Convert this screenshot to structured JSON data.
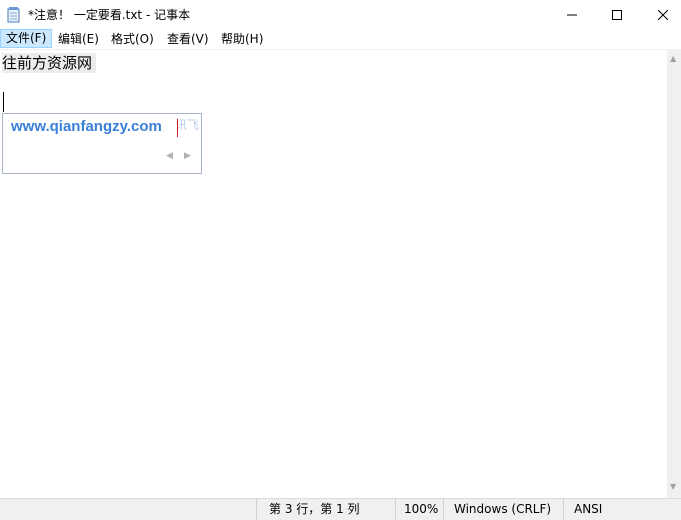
{
  "window": {
    "title": "*注意！ 一定要看.txt - 记事本",
    "icon": "notepad-icon",
    "controls": [
      "minimize-icon",
      "maximize-icon",
      "close-icon"
    ]
  },
  "menu": {
    "items": [
      {
        "label": "文件(F)"
      },
      {
        "label": "编辑(E)"
      },
      {
        "label": "格式(O)"
      },
      {
        "label": "查看(V)"
      },
      {
        "label": "帮助(H)"
      }
    ]
  },
  "editor": {
    "line1": "往前方资源网",
    "ime_composition": "www.qianfangzy.com",
    "ime_logo": "讯飞"
  },
  "status": {
    "position": "第 3 行，第 1 列",
    "zoom": "100%",
    "line_ending": "Windows (CRLF)",
    "encoding": "ANSI"
  },
  "colors": {
    "ime_text": "#3a7fd8",
    "menu_highlight": "#cce8ff"
  }
}
